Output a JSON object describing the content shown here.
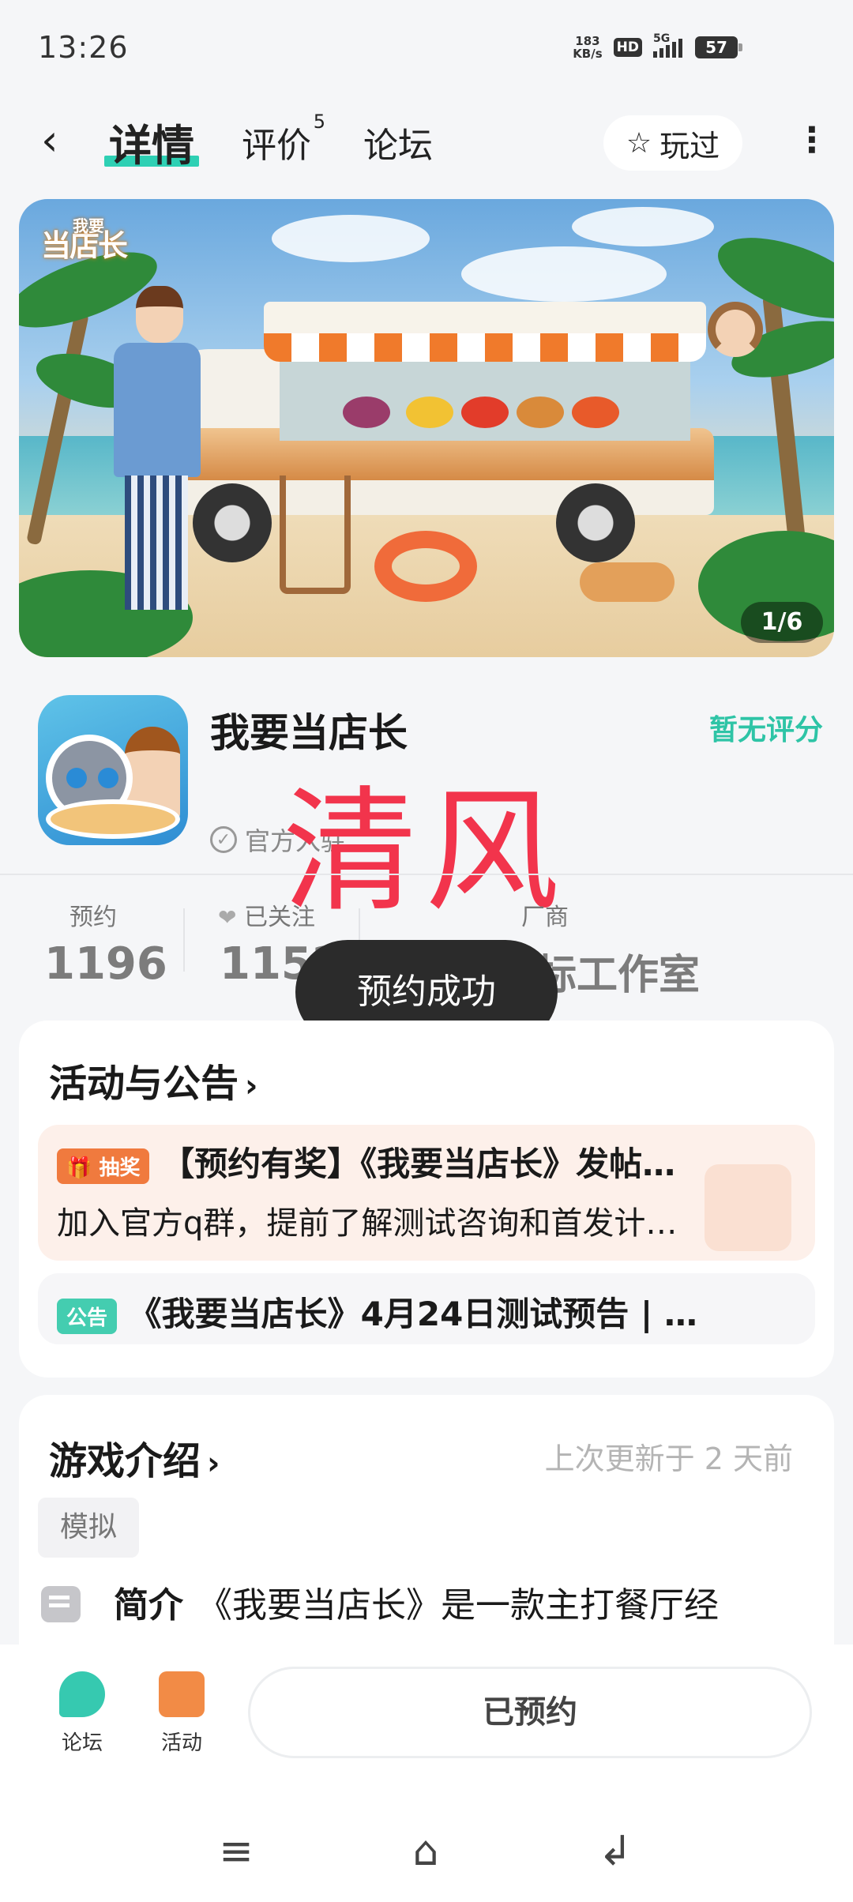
{
  "status_bar": {
    "time": "13:26",
    "net_speed_value": "183",
    "net_speed_unit": "KB/s",
    "hd": "HD",
    "network": "5G",
    "battery": "57"
  },
  "nav": {
    "back_icon": "back-arrow-icon",
    "tabs": [
      {
        "label": "详情",
        "active": true
      },
      {
        "label": "评价",
        "badge": "5"
      },
      {
        "label": "论坛"
      }
    ],
    "played_label": "玩过",
    "more_icon": "more-vertical-icon"
  },
  "banner": {
    "logo_small": "我要",
    "logo_text": "当店长",
    "page_indicator": "1/6"
  },
  "app": {
    "name": "我要当店长",
    "rating": "暂无评分",
    "official_label": "官方入驻"
  },
  "watermark": "清风",
  "stats": {
    "reservations_label": "预约",
    "reservations_value": "1196",
    "following_label": "已关注",
    "following_value": "1152",
    "developer_label": "厂商",
    "developer_value": "目标工作室"
  },
  "toast": "预约成功",
  "activities": {
    "title": "活动与公告",
    "items": [
      {
        "tag": "抽奖",
        "line1": "【预约有奖】《我要当店长》发帖…",
        "line2": "加入官方q群，提前了解测试咨询和首发计…"
      },
      {
        "tag": "公告",
        "line1": "《我要当店长》4月24日测试预告 | …"
      }
    ]
  },
  "intro": {
    "title": "游戏介绍",
    "update_time": "上次更新于 2 天前",
    "genre": "模拟",
    "summary_label": "简介",
    "summary_text": "《我要当店长》是一款主打餐厅经"
  },
  "bottom_bar": {
    "forum_label": "论坛",
    "activity_label": "活动",
    "reserved_label": "已预约"
  },
  "colors": {
    "accent": "#2ed0b4",
    "lottery": "#f07a3e",
    "announce": "#44cdb0",
    "watermark": "#f2344c"
  }
}
